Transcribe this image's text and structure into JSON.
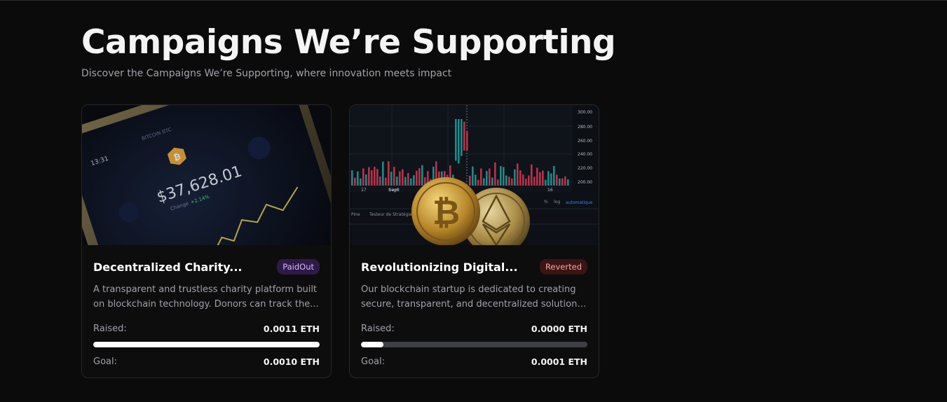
{
  "section": {
    "title": "Campaigns We’re Supporting",
    "subtitle": "Discover the Campaigns We’re Supporting, where innovation meets impact"
  },
  "campaigns": [
    {
      "title": "Decentralized Charity...",
      "status": "PaidOut",
      "description_lines": [
        "A transparent and trustless charity platform built",
        "on blockchain technology. Donors can track the..."
      ],
      "raised_label": "Raised:",
      "raised": "0.0011 ETH",
      "goal_label": "Goal:",
      "goal": "0.0010 ETH",
      "progress_fraction": 1.0,
      "image": {
        "phone_time": "13:31",
        "price_text": "$37,628.01",
        "change_label": "Change",
        "change_value": "+2.14%"
      }
    },
    {
      "title": "Revolutionizing Digital...",
      "status": "Reverted",
      "description_lines": [
        "Our blockchain startup is dedicated to creating",
        "secure, transparent, and decentralized solutions..."
      ],
      "raised_label": "Raised:",
      "raised": "0.0000 ETH",
      "goal_label": "Goal:",
      "goal": "0.0001 ETH",
      "progress_fraction": 0.1,
      "image": {
        "axis_labels": [
          "300.00",
          "280.00",
          "260.00",
          "240.00",
          "220.00",
          "200.00"
        ],
        "x_labels": [
          "17",
          "Sept",
          "16"
        ],
        "footer_left": "Pine",
        "footer_tab": "Testeur de Stratégie",
        "percent_label": "%",
        "log_label": "log",
        "auto_label": "automatique"
      }
    }
  ],
  "colors": {
    "background": "#0b0b0b",
    "paid_badge_bg": "#2e1a47",
    "paid_badge_text": "#d8b4fe",
    "reverted_badge_bg": "#3b1414",
    "reverted_badge_text": "#fca5a5",
    "progress_track": "#3f3f46",
    "progress_fill": "#ffffff"
  }
}
